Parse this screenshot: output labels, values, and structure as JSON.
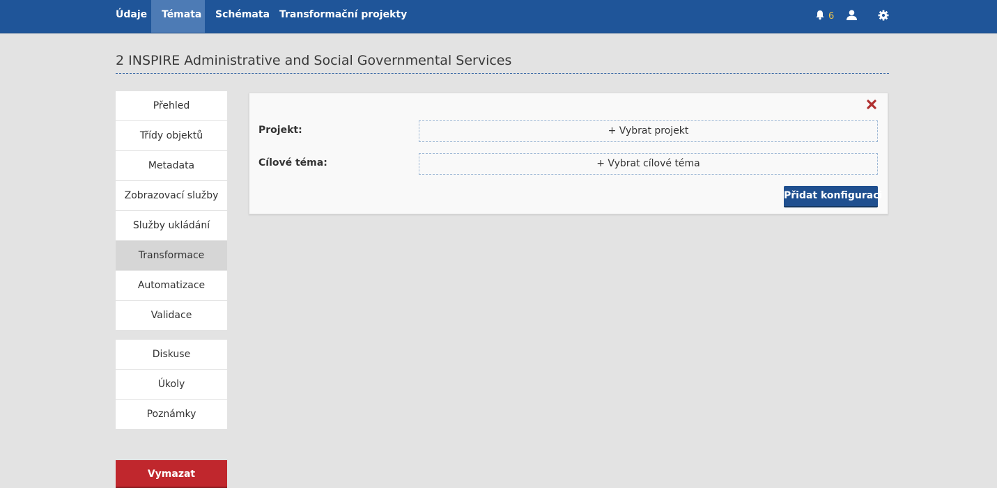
{
  "nav": {
    "items": [
      {
        "label": "Údaje"
      },
      {
        "label": "Témata"
      },
      {
        "label": "Schémata"
      },
      {
        "label": "Transformační projekty"
      }
    ],
    "active_index": 1,
    "notifications": {
      "count": "6",
      "icon": "bell-icon"
    },
    "user_icon": "user-icon",
    "settings_icon": "gear-icon"
  },
  "page": {
    "title": "2 INSPIRE Administrative and Social Governmental Services"
  },
  "sidebar": {
    "items": [
      {
        "label": "Přehled"
      },
      {
        "label": "Třídy objektů"
      },
      {
        "label": "Metadata"
      },
      {
        "label": "Zobrazovací služby"
      },
      {
        "label": "Služby ukládání"
      },
      {
        "label": "Transformace"
      },
      {
        "label": "Automatizace"
      },
      {
        "label": "Validace"
      }
    ],
    "active_index": 5,
    "secondary_items": [
      {
        "label": "Diskuse"
      },
      {
        "label": "Úkoly"
      },
      {
        "label": "Poznámky"
      }
    ],
    "delete_label": "Vymazat"
  },
  "panel": {
    "project_label": "Projekt:",
    "project_select": "+ Vybrat projekt",
    "target_label": "Cílové téma:",
    "target_select": "+ Vybrat cílové téma",
    "add_button": "Přidat konfiguraci",
    "close_icon": "close-icon"
  },
  "colors": {
    "nav_bg": "#1f5599",
    "nav_active": "#4d7bb5",
    "badge": "#f0c64a",
    "delete": "#c0272d",
    "primary_button": "#1f4f8f",
    "close": "#b03030"
  }
}
